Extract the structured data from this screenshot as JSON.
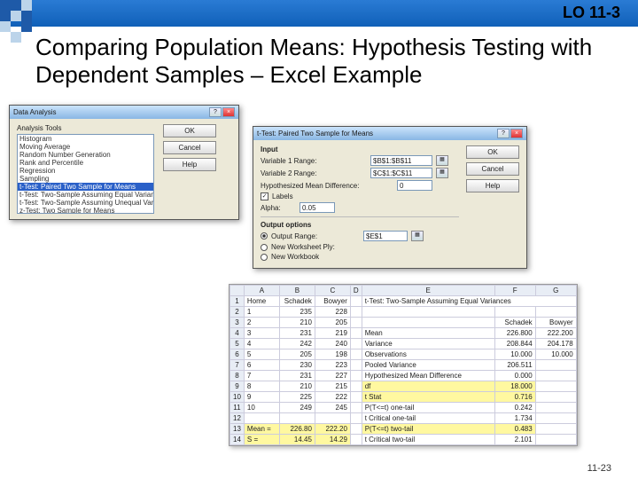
{
  "header": {
    "lo": "LO 11-3"
  },
  "title": "Comparing Population Means: Hypothesis Testing with Dependent Samples – Excel Example",
  "footnote": "11-23",
  "dialog1": {
    "title": "Data Analysis",
    "group": "Analysis Tools",
    "items": [
      "Histogram",
      "Moving Average",
      "Random Number Generation",
      "Rank and Percentile",
      "Regression",
      "Sampling",
      "t-Test: Paired Two Sample for Means",
      "t-Test: Two-Sample Assuming Equal Variances",
      "t-Test: Two-Sample Assuming Unequal Variances",
      "z-Test: Two Sample for Means"
    ],
    "selected": 6,
    "buttons": {
      "ok": "OK",
      "cancel": "Cancel",
      "help": "Help"
    }
  },
  "dialog2": {
    "title": "t-Test: Paired Two Sample for Means",
    "input_label": "Input",
    "var1": "Variable 1 Range:",
    "var1_val": "$B$1:$B$11",
    "var2": "Variable 2 Range:",
    "var2_val": "$C$1:$C$11",
    "hmd": "Hypothesized Mean Difference:",
    "hmd_val": "0",
    "labels": "Labels",
    "alpha": "Alpha:",
    "alpha_val": "0.05",
    "output_label": "Output options",
    "out_range": "Output Range:",
    "out_range_val": "$E$1",
    "out_new": "New Worksheet Ply:",
    "out_wb": "New Workbook",
    "buttons": {
      "ok": "OK",
      "cancel": "Cancel",
      "help": "Help"
    }
  },
  "sheet": {
    "cols": [
      "",
      "A",
      "B",
      "C",
      "D",
      "E",
      "F",
      "G"
    ],
    "rows": [
      {
        "n": "1",
        "A": "Home",
        "B": "Schadek",
        "C": "Bowyer",
        "E": "t-Test: Two-Sample Assuming Equal Variances"
      },
      {
        "n": "2",
        "A": "1",
        "B": "235",
        "C": "228"
      },
      {
        "n": "3",
        "A": "2",
        "B": "210",
        "C": "205",
        "F": "Schadek",
        "G": "Bowyer"
      },
      {
        "n": "4",
        "A": "3",
        "B": "231",
        "C": "219",
        "E": "Mean",
        "F": "226.800",
        "G": "222.200"
      },
      {
        "n": "5",
        "A": "4",
        "B": "242",
        "C": "240",
        "E": "Variance",
        "F": "208.844",
        "G": "204.178"
      },
      {
        "n": "6",
        "A": "5",
        "B": "205",
        "C": "198",
        "E": "Observations",
        "F": "10.000",
        "G": "10.000"
      },
      {
        "n": "7",
        "A": "6",
        "B": "230",
        "C": "223",
        "E": "Pooled Variance",
        "F": "206.511"
      },
      {
        "n": "8",
        "A": "7",
        "B": "231",
        "C": "227",
        "E": "Hypothesized Mean Difference",
        "F": "0.000"
      },
      {
        "n": "9",
        "A": "8",
        "B": "210",
        "C": "215",
        "E": "df",
        "F": "18.000",
        "yE": true,
        "yF": true
      },
      {
        "n": "10",
        "A": "9",
        "B": "225",
        "C": "222",
        "E": "t Stat",
        "F": "0.716",
        "yE": true,
        "yF": true
      },
      {
        "n": "11",
        "A": "10",
        "B": "249",
        "C": "245",
        "E": "P(T<=t) one-tail",
        "F": "0.242"
      },
      {
        "n": "12",
        "E": "t Critical one-tail",
        "F": "1.734"
      },
      {
        "n": "13",
        "A": "Mean =",
        "B": "226.80",
        "C": "222.20",
        "E": "P(T<=t) two-tail",
        "F": "0.483",
        "yA": true,
        "yB": true,
        "yC": true,
        "yE": true,
        "yF": true
      },
      {
        "n": "14",
        "A": "S =",
        "B": "14.45",
        "C": "14.29",
        "E": "t Critical two-tail",
        "F": "2.101",
        "yA": true,
        "yB": true,
        "yC": true
      }
    ]
  }
}
